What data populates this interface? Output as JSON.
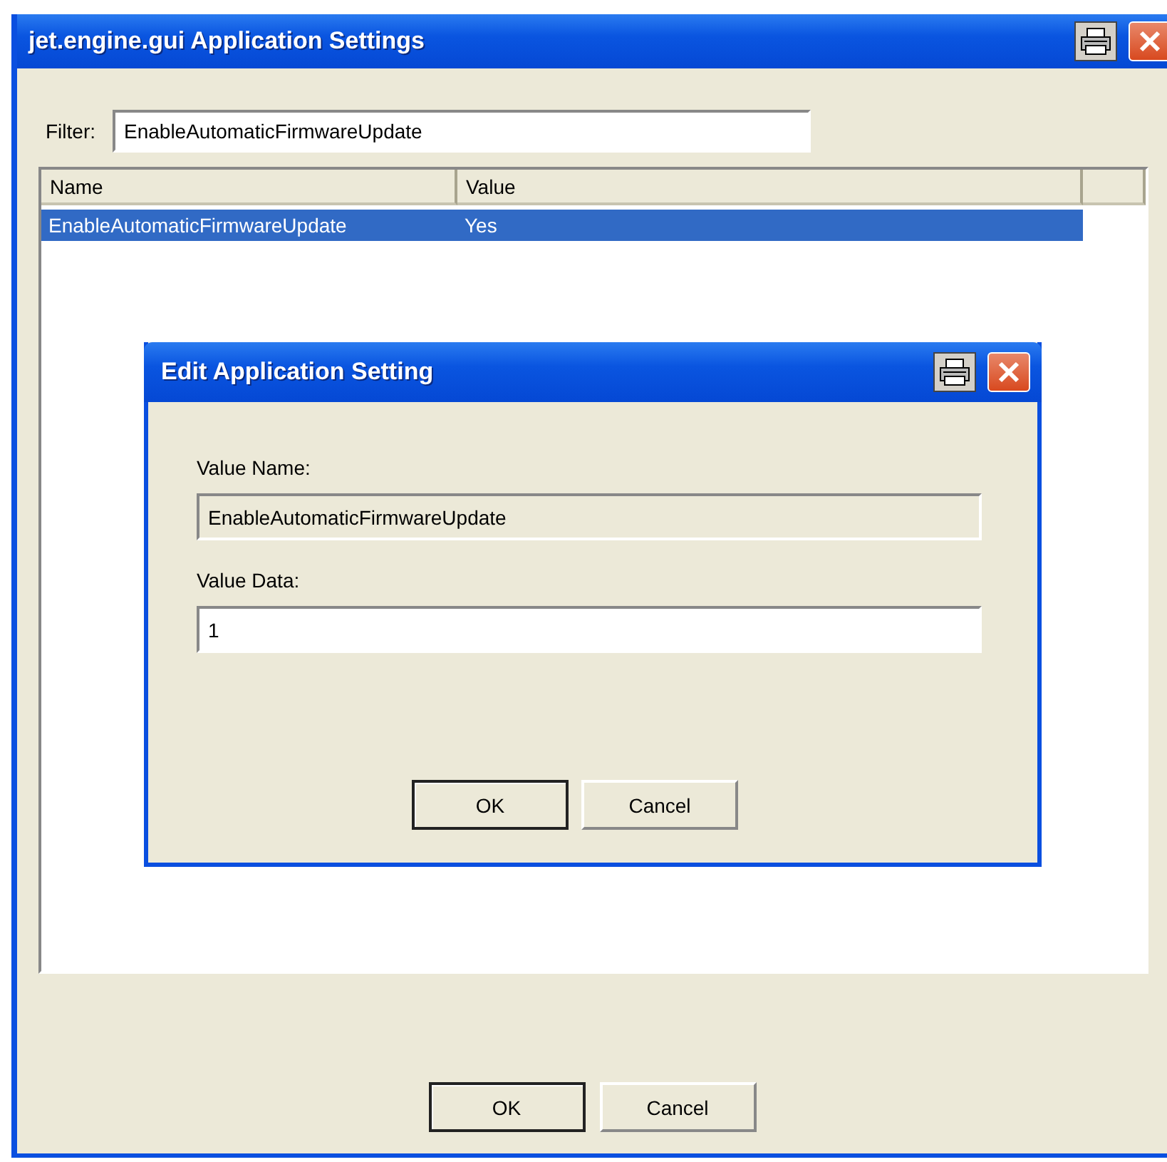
{
  "window": {
    "title": "jet.engine.gui Application Settings"
  },
  "filter": {
    "label": "Filter:",
    "value": "EnableAutomaticFirmwareUpdate"
  },
  "table": {
    "columns": [
      "Name",
      "Value"
    ],
    "rows": [
      {
        "cells": [
          "EnableAutomaticFirmwareUpdate",
          "Yes"
        ],
        "selected": true
      }
    ]
  },
  "buttons": [
    {
      "label": "OK",
      "default": true
    },
    {
      "label": "Cancel",
      "default": false
    }
  ],
  "dialog": {
    "title": "Edit Application Setting",
    "fields": [
      {
        "label": "Value Name:",
        "value": "EnableAutomaticFirmwareUpdate",
        "disabled": true
      },
      {
        "label": "Value Data:",
        "value": "1",
        "disabled": false
      }
    ],
    "buttons": [
      {
        "label": "OK",
        "default": true
      },
      {
        "label": "Cancel",
        "default": false
      }
    ]
  }
}
